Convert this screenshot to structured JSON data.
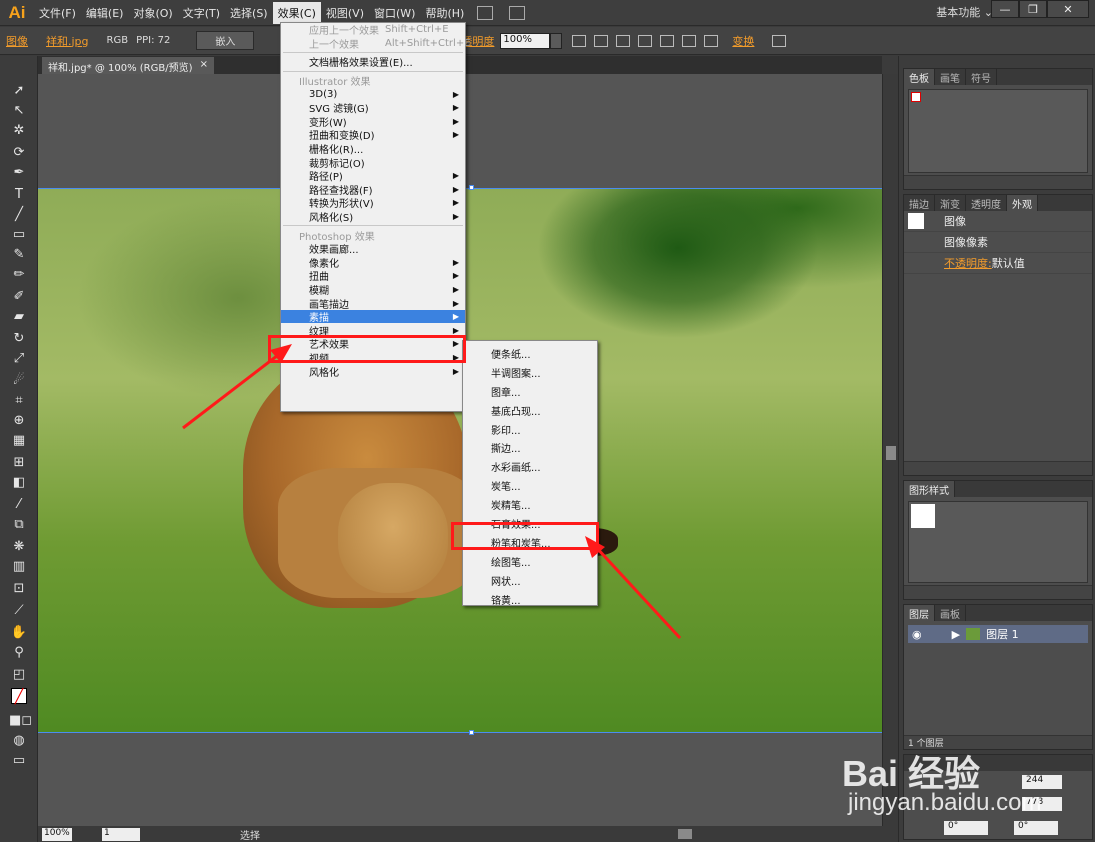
{
  "app": {
    "logo": "Ai",
    "workspace": "基本功能 ⌄",
    "window_buttons": [
      "—",
      "❐",
      "✕"
    ]
  },
  "menubar": {
    "items": [
      "文件(F)",
      "编辑(E)",
      "对象(O)",
      "文字(T)",
      "选择(S)",
      "效果(C)",
      "视图(V)",
      "窗口(W)",
      "帮助(H)"
    ]
  },
  "controlbar": {
    "object_type": "图像",
    "filename": "祥和.jpg",
    "color_mode": "RGB",
    "ppi": "PPI: 72",
    "embed_button": "嵌入",
    "opacity_label": "不透明度",
    "opacity_value": "100%",
    "transform_label": "变换"
  },
  "document": {
    "tab_title": "祥和.jpg* @ 100% (RGB/预览)",
    "tab_close": "×"
  },
  "statusbar": {
    "zoom": "100%",
    "page": "1",
    "status": "选择"
  },
  "effect_menu": {
    "items": [
      {
        "label": "应用上一个效果",
        "shortcut": "Shift+Ctrl+E",
        "disabled": true
      },
      {
        "label": "上一个效果",
        "shortcut": "Alt+Shift+Ctrl+E",
        "disabled": true
      },
      {
        "label": "文档栅格效果设置(E)..."
      },
      {
        "label": "Illustrator 效果",
        "header": true
      },
      {
        "label": "3D(3)",
        "submenu": true
      },
      {
        "label": "SVG 滤镜(G)",
        "submenu": true
      },
      {
        "label": "变形(W)",
        "submenu": true
      },
      {
        "label": "扭曲和变换(D)",
        "submenu": true
      },
      {
        "label": "栅格化(R)..."
      },
      {
        "label": "裁剪标记(O)"
      },
      {
        "label": "路径(P)",
        "submenu": true
      },
      {
        "label": "路径查找器(F)",
        "submenu": true
      },
      {
        "label": "转换为形状(V)",
        "submenu": true
      },
      {
        "label": "风格化(S)",
        "submenu": true
      },
      {
        "label": "Photoshop 效果",
        "header": true
      },
      {
        "label": "效果画廊..."
      },
      {
        "label": "像素化",
        "submenu": true
      },
      {
        "label": "扭曲",
        "submenu": true
      },
      {
        "label": "模糊",
        "submenu": true
      },
      {
        "label": "画笔描边",
        "submenu": true
      },
      {
        "label": "素描",
        "submenu": true,
        "highlight": true
      },
      {
        "label": "纹理",
        "submenu": true
      },
      {
        "label": "艺术效果",
        "submenu": true
      },
      {
        "label": "视频",
        "submenu": true
      },
      {
        "label": "风格化",
        "submenu": true
      }
    ]
  },
  "sketch_submenu": {
    "items": [
      "便条纸...",
      "半调图案...",
      "图章...",
      "基底凸现...",
      "影印...",
      "撕边...",
      "水彩画纸...",
      "炭笔...",
      "炭精笔...",
      "石膏效果...",
      "粉笔和炭笔...",
      "绘图笔...",
      "网状...",
      "铬黄..."
    ],
    "highlighted_index": 10
  },
  "panels": {
    "swatches": {
      "tabs": [
        "色板",
        "画笔",
        "符号"
      ]
    },
    "appearance": {
      "tabs": [
        "描边",
        "渐变",
        "透明度",
        "外观"
      ],
      "title": "图像",
      "row1": "图像像素",
      "opacity_label": "不透明度:",
      "opacity_value": "默认值"
    },
    "graphic_styles": {
      "tabs": [
        "图形样式"
      ]
    },
    "layers": {
      "tabs": [
        "图层",
        "画板"
      ],
      "layer_name": "图层 1",
      "footer": "1 个图层"
    },
    "transform": {
      "x_value": "244",
      "w_value": "778",
      "rotate_value": "0°",
      "shear_value": "0°"
    }
  },
  "watermark": {
    "text": "Bai 经验",
    "sub": "jingyan.baidu.com"
  },
  "colors": {
    "accent_orange": "#f39c2b",
    "highlight_blue": "#3b82e0",
    "annotation_red": "#ff1a1a"
  }
}
